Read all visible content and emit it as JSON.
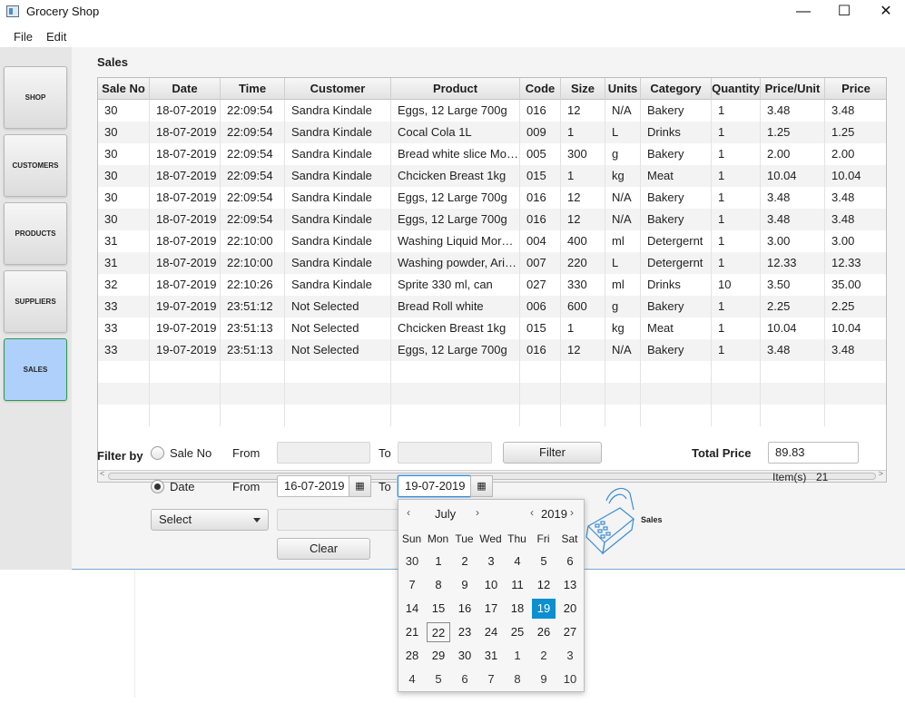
{
  "window": {
    "title": "Grocery Shop",
    "minimize": "—",
    "maximize": "☐",
    "close": "✕"
  },
  "menu": {
    "file": "File",
    "edit": "Edit"
  },
  "sidebar": {
    "items": [
      {
        "label": "SHOP"
      },
      {
        "label": "CUSTOMERS"
      },
      {
        "label": "PRODUCTS"
      },
      {
        "label": "SUPPLIERS"
      },
      {
        "label": "SALES",
        "active": true
      }
    ]
  },
  "section_title": "Sales",
  "table": {
    "columns": [
      "Sale No",
      "Date",
      "Time",
      "Customer",
      "Product",
      "Code",
      "Size",
      "Units",
      "Category",
      "Quantity",
      "Price/Unit",
      "Price"
    ],
    "rows": [
      [
        "30",
        "18-07-2019",
        "22:09:54",
        "Sandra Kindale",
        "Eggs, 12 Large 700g",
        "016",
        "12",
        "N/A",
        "Bakery",
        "1",
        "3.48",
        "3.48"
      ],
      [
        "30",
        "18-07-2019",
        "22:09:54",
        "Sandra Kindale",
        "Cocal Cola 1L",
        "009",
        "1",
        "L",
        "Drinks",
        "1",
        "1.25",
        "1.25"
      ],
      [
        "30",
        "18-07-2019",
        "22:09:54",
        "Sandra Kindale",
        "Bread white slice Morni...",
        "005",
        "300",
        "g",
        "Bakery",
        "1",
        "2.00",
        "2.00"
      ],
      [
        "30",
        "18-07-2019",
        "22:09:54",
        "Sandra Kindale",
        "Chcicken Breast 1kg",
        "015",
        "1",
        "kg",
        "Meat",
        "1",
        "10.04",
        "10.04"
      ],
      [
        "30",
        "18-07-2019",
        "22:09:54",
        "Sandra Kindale",
        "Eggs, 12 Large 700g",
        "016",
        "12",
        "N/A",
        "Bakery",
        "1",
        "3.48",
        "3.48"
      ],
      [
        "30",
        "18-07-2019",
        "22:09:54",
        "Sandra Kindale",
        "Eggs, 12 Large 700g",
        "016",
        "12",
        "N/A",
        "Bakery",
        "1",
        "3.48",
        "3.48"
      ],
      [
        "31",
        "18-07-2019",
        "22:10:00",
        "Sandra Kindale",
        "Washing Liquid Morning",
        "004",
        "400",
        "ml",
        "Detergernt",
        "1",
        "3.00",
        "3.00"
      ],
      [
        "31",
        "18-07-2019",
        "22:10:00",
        "Sandra Kindale",
        "Washing powder, Ariel ...",
        "007",
        "220",
        "L",
        "Detergernt",
        "1",
        "12.33",
        "12.33"
      ],
      [
        "32",
        "18-07-2019",
        "22:10:26",
        "Sandra Kindale",
        "Sprite 330 ml, can",
        "027",
        "330",
        "ml",
        "Drinks",
        "10",
        "3.50",
        "35.00"
      ],
      [
        "33",
        "19-07-2019",
        "23:51:12",
        "Not Selected",
        "Bread Roll white",
        "006",
        "600",
        "g",
        "Bakery",
        "1",
        "2.25",
        "2.25"
      ],
      [
        "33",
        "19-07-2019",
        "23:51:13",
        "Not Selected",
        "Chcicken Breast 1kg",
        "015",
        "1",
        "kg",
        "Meat",
        "1",
        "10.04",
        "10.04"
      ],
      [
        "33",
        "19-07-2019",
        "23:51:13",
        "Not Selected",
        "Eggs, 12 Large 700g",
        "016",
        "12",
        "N/A",
        "Bakery",
        "1",
        "3.48",
        "3.48"
      ]
    ]
  },
  "filter": {
    "filter_by": "Filter by",
    "sale_no_label": "Sale No",
    "date_label": "Date",
    "from": "From",
    "to": "To",
    "date_from": "16-07-2019",
    "date_to": "19-07-2019",
    "filter_button": "Filter",
    "clear_button": "Clear",
    "select_value": "Select"
  },
  "totals": {
    "total_price_label": "Total Price",
    "total_price": "89.83",
    "items_label": "Item(s)",
    "items_count": "21"
  },
  "graphic_caption": "Sales",
  "calendar": {
    "month": "July",
    "year": "2019",
    "prev": "‹",
    "next": "›",
    "weekdays": [
      "Sun",
      "Mon",
      "Tue",
      "Wed",
      "Thu",
      "Fri",
      "Sat"
    ],
    "weeks": [
      [
        "30",
        "1",
        "2",
        "3",
        "4",
        "5",
        "6"
      ],
      [
        "7",
        "8",
        "9",
        "10",
        "11",
        "12",
        "13"
      ],
      [
        "14",
        "15",
        "16",
        "17",
        "18",
        "19",
        "20"
      ],
      [
        "21",
        "22",
        "23",
        "24",
        "25",
        "26",
        "27"
      ],
      [
        "28",
        "29",
        "30",
        "31",
        "1",
        "2",
        "3"
      ],
      [
        "4",
        "5",
        "6",
        "7",
        "8",
        "9",
        "10"
      ]
    ],
    "selected": "19",
    "today": "22"
  },
  "colors": {
    "accent": "#0a8fd1",
    "active_nav": "#aed0fb",
    "active_nav_border": "#2f9a4c"
  }
}
